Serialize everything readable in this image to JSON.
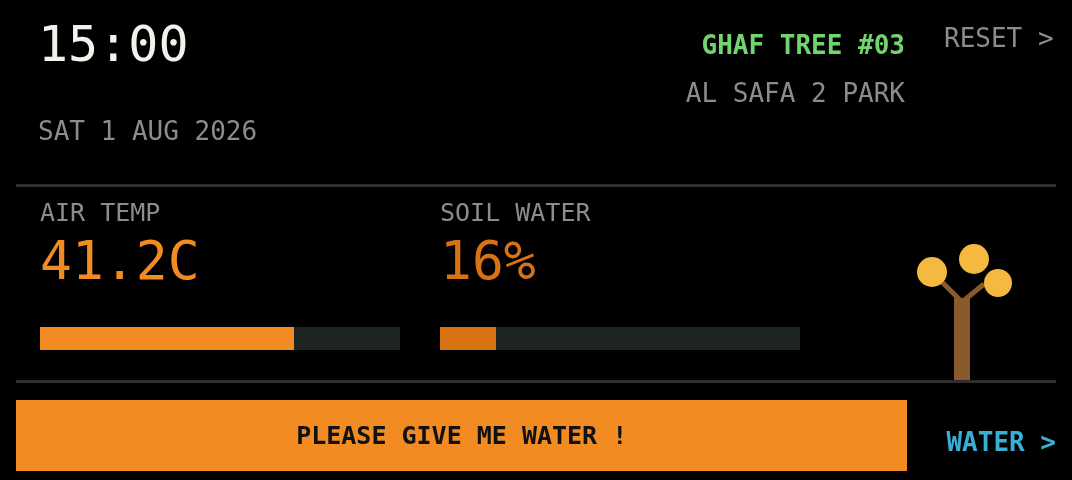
{
  "clock": {
    "time": "15:00",
    "date": "SAT 1 AUG 2026"
  },
  "tree": {
    "name": "GHAF TREE #03",
    "location": "AL SAFA 2 PARK"
  },
  "reset_link": "RESET >",
  "metrics": [
    {
      "label": "AIR TEMP",
      "reading": "41.2C",
      "level": 0.706,
      "color": "#f28c22"
    },
    {
      "label": "SOIL WATER",
      "reading": "16%",
      "level": 0.156,
      "color": "#d87212"
    }
  ],
  "alert": {
    "message": "PLEASE GIVE ME WATER !"
  },
  "water_link": "WATER >"
}
